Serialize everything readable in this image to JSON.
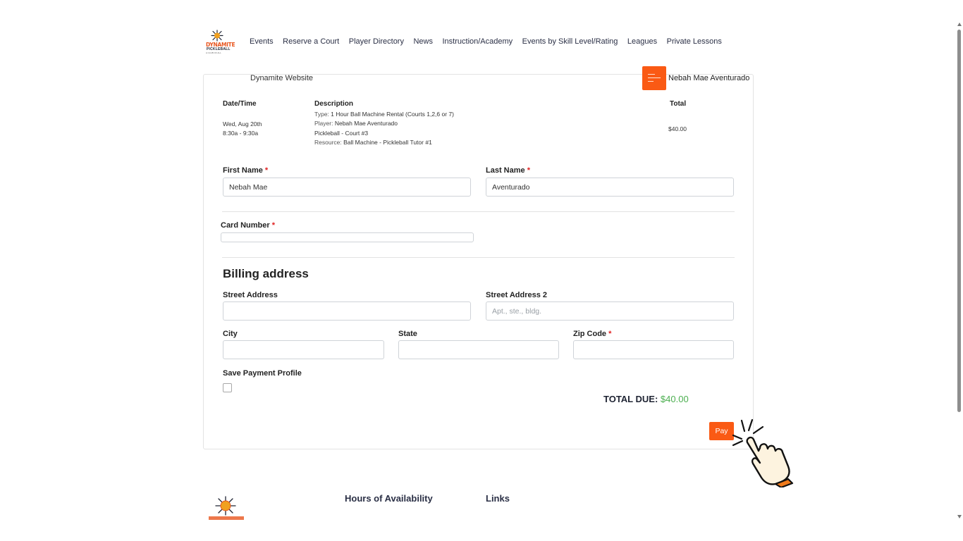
{
  "brand": {
    "logo_word": "DYNAMITE",
    "logo_sub": "PICKLEBALL",
    "logo_tag": "A CLUB OF ALL",
    "accent": "#fa5a14"
  },
  "nav": {
    "items": [
      {
        "label": "Events"
      },
      {
        "label": "Reserve a Court"
      },
      {
        "label": "Player Directory"
      },
      {
        "label": "News"
      },
      {
        "label": "Instruction/Academy"
      },
      {
        "label": "Events by Skill Level/Rating"
      },
      {
        "label": "Leagues"
      },
      {
        "label": "Private Lessons"
      }
    ]
  },
  "header": {
    "site_name": "Dynamite Website",
    "menu_icon": "hamburger-icon",
    "user_name": "Nebah Mae Aventurado"
  },
  "order": {
    "headers": {
      "datetime": "Date/Time",
      "description": "Description",
      "total": "Total"
    },
    "date": "Wed, Aug 20th",
    "time": "8:30a - 9:30a",
    "type_key": "Type:",
    "type_val": "1 Hour Ball Machine Rental (Courts 1,2,6 or 7)",
    "player_key": "Player:",
    "player_val": "Nebah Mae Aventurado",
    "court": "Pickleball - Court #3",
    "resource_key": "Resource:",
    "resource_val": "Ball Machine - Pickleball Tutor #1",
    "amount": "$40.00"
  },
  "form": {
    "first_name_label": "First Name",
    "first_name_value": "Nebah Mae",
    "last_name_label": "Last Name",
    "last_name_value": "Aventurado",
    "required_mark": "*",
    "card_number_label": "Card Number",
    "billing_title": "Billing address",
    "street_label": "Street Address",
    "street2_label": "Street Address 2",
    "street2_placeholder": "Apt., ste., bldg.",
    "city_label": "City",
    "state_label": "State",
    "zip_label": "Zip Code",
    "save_profile_label": "Save Payment Profile"
  },
  "summary": {
    "total_label": "TOTAL DUE:",
    "total_value": "$40.00",
    "total_color": "#4caf50",
    "pay_label": "Pay"
  },
  "footer": {
    "hours_heading": "Hours of Availability",
    "links_heading": "Links"
  }
}
